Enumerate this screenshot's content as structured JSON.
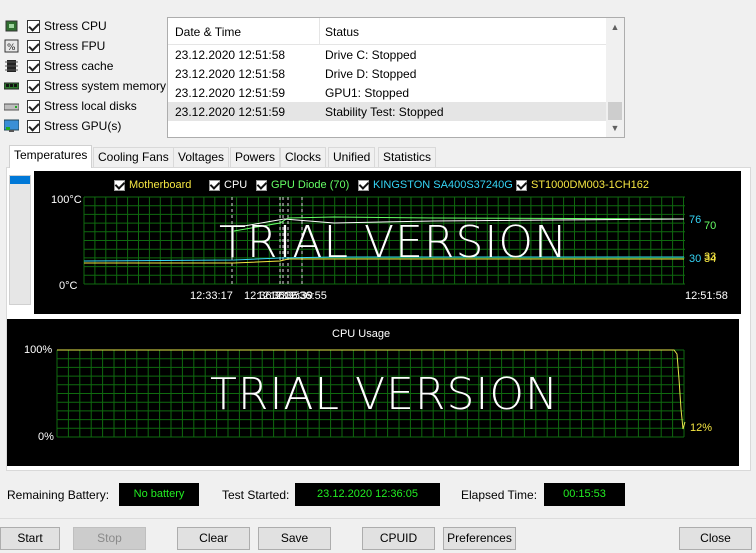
{
  "stress_options": [
    {
      "label": "Stress CPU",
      "checked": true,
      "icon": "cpu-chip-icon"
    },
    {
      "label": "Stress FPU",
      "checked": true,
      "icon": "fpu-icon"
    },
    {
      "label": "Stress cache",
      "checked": true,
      "icon": "cache-icon"
    },
    {
      "label": "Stress system memory",
      "checked": true,
      "icon": "memory-icon"
    },
    {
      "label": "Stress local disks",
      "checked": true,
      "icon": "disk-icon"
    },
    {
      "label": "Stress GPU(s)",
      "checked": true,
      "icon": "gpu-monitor-icon"
    }
  ],
  "log": {
    "columns": [
      "Date & Time",
      "Status"
    ],
    "rows": [
      {
        "time": "23.12.2020 12:51:58",
        "status": "Drive C: Stopped"
      },
      {
        "time": "23.12.2020 12:51:58",
        "status": "Drive D: Stopped"
      },
      {
        "time": "23.12.2020 12:51:59",
        "status": "GPU1: Stopped"
      },
      {
        "time": "23.12.2020 12:51:59",
        "status": "Stability Test: Stopped",
        "selected": true
      }
    ]
  },
  "tabs": [
    {
      "label": "Temperatures",
      "active": true
    },
    {
      "label": "Cooling Fans"
    },
    {
      "label": "Voltages"
    },
    {
      "label": "Powers"
    },
    {
      "label": "Clocks"
    },
    {
      "label": "Unified"
    },
    {
      "label": "Statistics"
    }
  ],
  "temp_chart": {
    "legend": [
      {
        "label": "Motherboard",
        "color": "#f5e642"
      },
      {
        "label": "CPU",
        "color": "#ffffff"
      },
      {
        "label": "GPU Diode (70)",
        "color": "#66ff66"
      },
      {
        "label": "KINGSTON SA400S37240G",
        "color": "#35d4f5"
      },
      {
        "label": "ST1000DM003-1CH162",
        "color": "#f5e642"
      }
    ],
    "y_max_label": "100°C",
    "y_min_label": "0°C",
    "x_labels": [
      "12:33:17",
      "12:36:33",
      "12:36:35",
      "12:36:39",
      "12:36:55"
    ],
    "x_label_end": "12:51:58",
    "watermark": "TRIAL VERSION",
    "end_values": [
      {
        "text": "76",
        "color": "#35d4f5"
      },
      {
        "text": "70",
        "color": "#66ff66"
      },
      {
        "text": "30",
        "color": "#35d4f5"
      },
      {
        "text": "33",
        "color": "#f5e642"
      },
      {
        "text": "34",
        "color": "#f5e642"
      }
    ]
  },
  "cpu_chart": {
    "title": "CPU Usage",
    "y_max_label": "100%",
    "y_min_label": "0%",
    "watermark": "TRIAL VERSION",
    "current_value": "12%"
  },
  "status": {
    "battery_label": "Remaining Battery:",
    "battery_value": "No battery",
    "started_label": "Test Started:",
    "started_value": "23.12.2020 12:36:05",
    "elapsed_label": "Elapsed Time:",
    "elapsed_value": "00:15:53"
  },
  "buttons": {
    "start": "Start",
    "stop": "Stop",
    "clear": "Clear",
    "save": "Save",
    "cpuid": "CPUID",
    "preferences": "Preferences",
    "close": "Close"
  },
  "colors": {
    "grid": "#0f6a0f",
    "status_text": "#22ee22",
    "selection_accent": "#0078d7"
  }
}
